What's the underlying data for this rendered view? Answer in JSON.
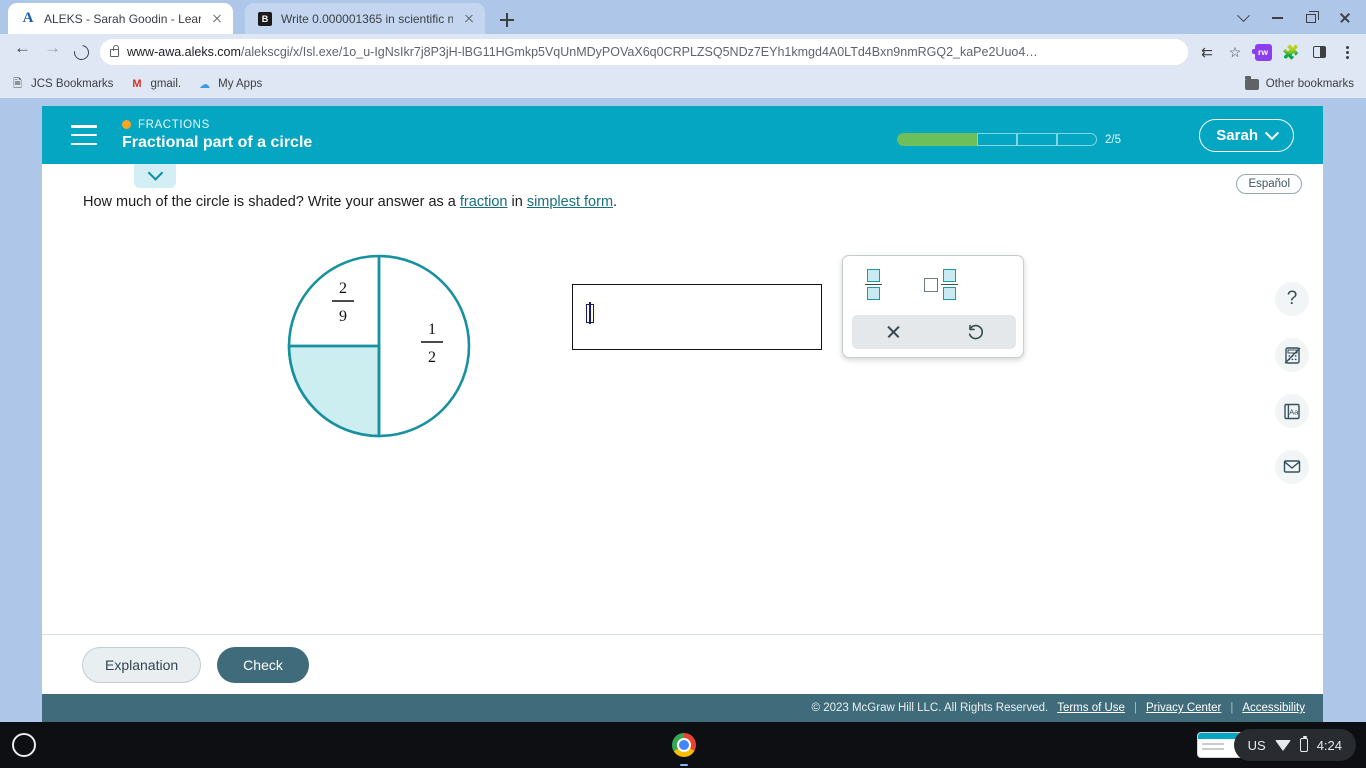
{
  "browser": {
    "tabs": [
      {
        "title": "ALEKS - Sarah Goodin - Learn",
        "favicon": "aleks-favicon",
        "active": true
      },
      {
        "title": "Write 0.000001365 in scientific n",
        "favicon": "brainly-favicon",
        "active": false
      }
    ],
    "new_tab_label": "+",
    "omnibox": {
      "domain": "www-awa.aleks.com",
      "path": "/alekscgi/x/Isl.exe/1o_u-IgNsIkr7j8P3jH-lBG11HGmkp5VqUnMDyPOVaX6q0CRPLZSQ5NDz7EYh1kmgd4A0LTd4Bxn9nmRGQ2_kaPe2Uuo4…"
    },
    "bookmarks": [
      {
        "label": "JCS Bookmarks",
        "icon": "bookmark-folder-icon"
      },
      {
        "label": "gmail.",
        "icon": "gmail-icon"
      },
      {
        "label": "My Apps",
        "icon": "cloud-icon"
      }
    ],
    "other_bookmarks": "Other bookmarks",
    "toolbar_icons": [
      "share-icon",
      "bookmark-star-icon",
      "readwrite-extension-icon",
      "extensions-puzzle-icon",
      "side-panel-icon",
      "chrome-menu-icon"
    ],
    "window_controls": [
      "tab-search-icon",
      "minimize-icon",
      "maximize-icon",
      "close-icon"
    ]
  },
  "aleks": {
    "menu_icon": "hamburger-menu-icon",
    "kicker": "FRACTIONS",
    "topic": "Fractional part of a circle",
    "progress": {
      "total": 5,
      "completed": 2,
      "label": "2/5"
    },
    "user": {
      "name": "Sarah",
      "chevron": "chevron-down-icon"
    },
    "collapse_icon": "chevron-down-icon",
    "espanol": "Español"
  },
  "question": {
    "part1": "How much of the circle is shaded? Write your answer as a ",
    "link1": "fraction",
    "part2": " in ",
    "link2": "simplest form",
    "part3": "."
  },
  "figure": {
    "labels": [
      {
        "numerator": "2",
        "denominator": "9"
      },
      {
        "numerator": "1",
        "denominator": "2"
      }
    ],
    "stroke_color": "#17919f",
    "shade_color": "#cdeef0"
  },
  "answer": {
    "value": "",
    "placeholder": ""
  },
  "palette": {
    "buttons": [
      {
        "name": "fraction-button",
        "label": "fraction"
      },
      {
        "name": "mixed-number-button",
        "label": "mixed number"
      }
    ],
    "actions": [
      {
        "name": "clear-button",
        "label": "clear",
        "icon": "close-x-icon"
      },
      {
        "name": "undo-button",
        "label": "undo",
        "icon": "undo-icon"
      }
    ]
  },
  "rail": [
    {
      "name": "help-icon",
      "glyph": "?"
    },
    {
      "name": "calculator-disabled-icon",
      "glyph": ""
    },
    {
      "name": "dictionary-icon",
      "glyph": "Aa"
    },
    {
      "name": "message-icon",
      "glyph": ""
    }
  ],
  "actions": {
    "explanation": "Explanation",
    "check": "Check"
  },
  "footer": {
    "copyright": "© 2023 McGraw Hill LLC. All Rights Reserved.",
    "links": [
      "Terms of Use",
      "Privacy Center",
      "Accessibility"
    ],
    "separator": "|"
  },
  "shelf": {
    "launcher": "launcher-icon",
    "chrome": "chrome-icon",
    "windows_preview": "window-stack-icon",
    "keyboard": "US",
    "wifi": "wifi-icon",
    "battery": "battery-icon",
    "time": "4:24"
  }
}
